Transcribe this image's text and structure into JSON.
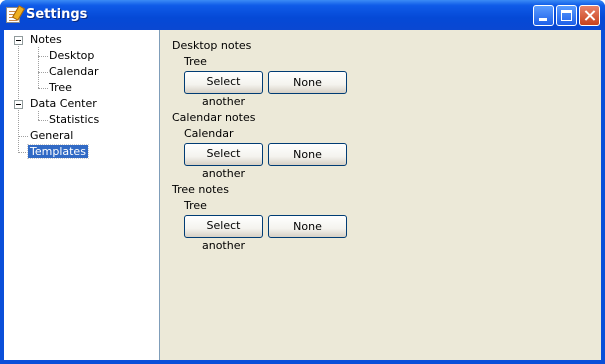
{
  "window": {
    "title": "Settings",
    "icons": {
      "app": "notepad-icon",
      "minimize": "minimize-icon",
      "maximize": "maximize-icon",
      "close": "close-icon"
    }
  },
  "tree": {
    "nodes": [
      {
        "label": "Notes",
        "expanded": true
      },
      {
        "label": "Desktop"
      },
      {
        "label": "Calendar"
      },
      {
        "label": "Tree"
      },
      {
        "label": "Data Center",
        "expanded": true
      },
      {
        "label": "Statistics"
      },
      {
        "label": "General"
      },
      {
        "label": "Templates",
        "selected": true
      }
    ]
  },
  "panel": {
    "groups": [
      {
        "title": "Desktop notes",
        "value": "Tree",
        "select_label": "Select another",
        "none_label": "None"
      },
      {
        "title": "Calendar notes",
        "value": "Calendar",
        "select_label": "Select another",
        "none_label": "None"
      },
      {
        "title": "Tree notes",
        "value": "Tree",
        "select_label": "Select another",
        "none_label": "None"
      }
    ]
  },
  "colors": {
    "title_bar": "#0a48d2",
    "selection": "#316ac5",
    "panel_bg": "#ece9d8"
  }
}
